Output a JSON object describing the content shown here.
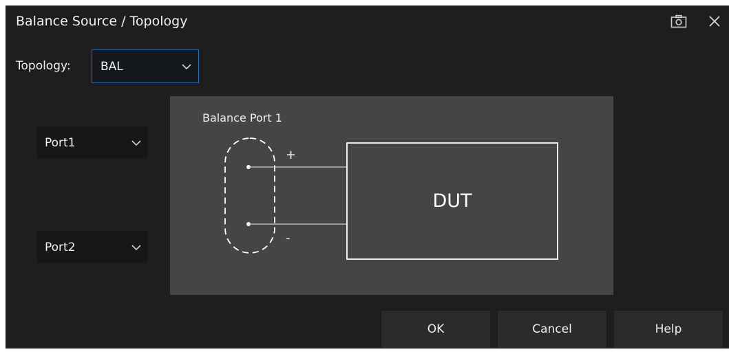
{
  "dialog": {
    "title": "Balance Source / Topology"
  },
  "topology": {
    "label": "Topology:",
    "selected": "BAL"
  },
  "ports": {
    "port1_selected": "Port1",
    "port2_selected": "Port2"
  },
  "diagram": {
    "port_label": "Balance Port 1",
    "plus": "+",
    "minus": "-",
    "dut_label": "DUT"
  },
  "buttons": {
    "ok": "OK",
    "cancel": "Cancel",
    "help": "Help"
  },
  "icons": {
    "camera": "camera-icon",
    "close": "close-icon",
    "dropdown": "chevron-down-icon"
  },
  "colors": {
    "dialog_bg": "#1e1e1e",
    "panel_bg": "#454545",
    "focus_border": "#2b6cb0"
  }
}
